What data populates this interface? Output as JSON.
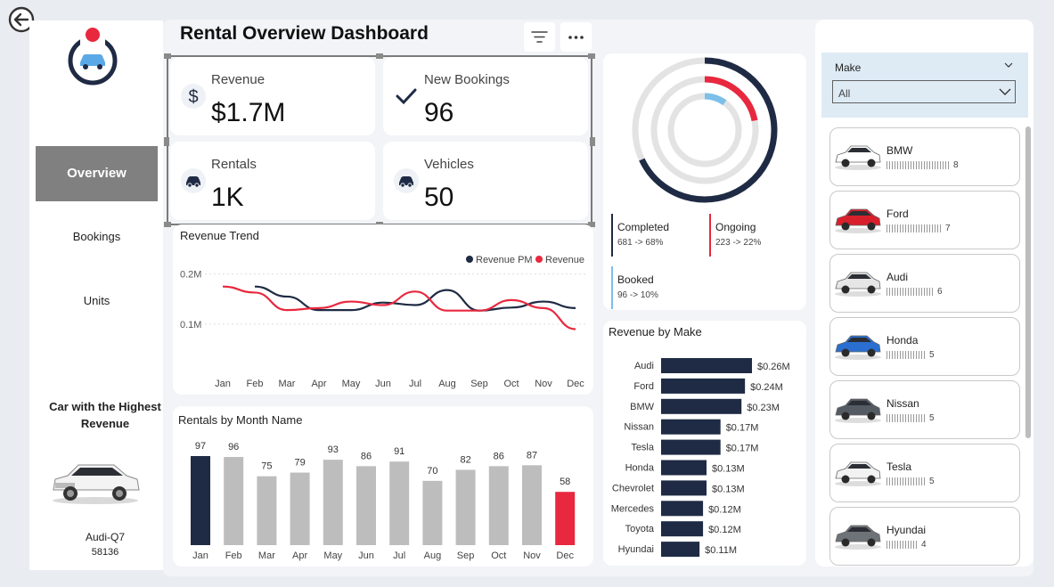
{
  "header": {
    "title": "Rental Overview Dashboard"
  },
  "nav": {
    "items": [
      {
        "label": "Overview"
      },
      {
        "label": "Bookings"
      },
      {
        "label": "Units"
      }
    ]
  },
  "top_car": {
    "title": "Car with the Highest Revenue",
    "name": "Audi-Q7",
    "value": "58136"
  },
  "kpis": [
    {
      "label": "Revenue",
      "value": "$1.7M",
      "icon": "dollar-icon"
    },
    {
      "label": "New Bookings",
      "value": "96",
      "icon": "checkmark-icon"
    },
    {
      "label": "Rentals",
      "value": "1K",
      "icon": "car-icon"
    },
    {
      "label": "Vehicles",
      "value": "50",
      "icon": "car-icon"
    }
  ],
  "status": [
    {
      "label": "Completed",
      "detail": "681 -> 68%",
      "color": "#1f2b44",
      "fraction": 0.68
    },
    {
      "label": "Ongoing",
      "detail": "223 -> 22%",
      "color": "#e8283e",
      "fraction": 0.22
    },
    {
      "label": "Booked",
      "detail": "96 -> 10%",
      "color": "#7cc0ea",
      "fraction": 0.1
    }
  ],
  "slicer": {
    "label": "Make",
    "value": "All"
  },
  "makes": [
    {
      "name": "BMW",
      "count": "8",
      "color": "#ffffff"
    },
    {
      "name": "Ford",
      "count": "7",
      "color": "#d8202c"
    },
    {
      "name": "Audi",
      "count": "6",
      "color": "#e6e6e6"
    },
    {
      "name": "Honda",
      "count": "5",
      "color": "#2a6fcf"
    },
    {
      "name": "Nissan",
      "count": "5",
      "color": "#555b63"
    },
    {
      "name": "Tesla",
      "count": "5",
      "color": "#f2f2f2"
    },
    {
      "name": "Hyundai",
      "count": "4",
      "color": "#6e7378"
    }
  ],
  "chart_data": [
    {
      "type": "line",
      "title": "Revenue Trend",
      "x": [
        "Jan",
        "Feb",
        "Mar",
        "Apr",
        "May",
        "Jun",
        "Jul",
        "Aug",
        "Sep",
        "Oct",
        "Nov",
        "Dec"
      ],
      "y_ticks": [
        "0.2M",
        "0.1M"
      ],
      "ylim": [
        0.05,
        0.21
      ],
      "legend_position": "top-right",
      "grid": true,
      "series": [
        {
          "name": "Revenue PM",
          "color": "#1f2b44",
          "values": [
            null,
            0.175,
            0.155,
            0.128,
            0.128,
            0.143,
            0.138,
            0.168,
            0.127,
            0.133,
            0.145,
            0.132
          ]
        },
        {
          "name": "Revenue",
          "color": "#e8283e",
          "values": [
            0.175,
            0.163,
            0.128,
            0.132,
            0.145,
            0.138,
            0.165,
            0.127,
            0.127,
            0.148,
            0.132,
            0.09
          ]
        }
      ]
    },
    {
      "type": "bar",
      "title": "Rentals by Month Name",
      "categories": [
        "Jan",
        "Feb",
        "Mar",
        "Apr",
        "May",
        "Jun",
        "Jul",
        "Aug",
        "Sep",
        "Oct",
        "Nov",
        "Dec"
      ],
      "values": [
        97,
        96,
        75,
        79,
        93,
        86,
        91,
        70,
        82,
        86,
        87,
        58
      ],
      "colors": [
        "#1f2b44",
        "#bdbdbd",
        "#bdbdbd",
        "#bdbdbd",
        "#bdbdbd",
        "#bdbdbd",
        "#bdbdbd",
        "#bdbdbd",
        "#bdbdbd",
        "#bdbdbd",
        "#bdbdbd",
        "#e8283e"
      ],
      "ylim": [
        0,
        97
      ]
    },
    {
      "type": "bar",
      "orientation": "horizontal",
      "title": "Revenue by Make",
      "categories": [
        "Audi",
        "Ford",
        "BMW",
        "Nissan",
        "Tesla",
        "Honda",
        "Chevrolet",
        "Mercedes",
        "Toyota",
        "Hyundai"
      ],
      "values": [
        0.26,
        0.24,
        0.23,
        0.17,
        0.17,
        0.13,
        0.13,
        0.12,
        0.12,
        0.11
      ],
      "labels": [
        "$0.26M",
        "$0.24M",
        "$0.23M",
        "$0.17M",
        "$0.17M",
        "$0.13M",
        "$0.13M",
        "$0.12M",
        "$0.12M",
        "$0.11M"
      ],
      "color": "#1f2b44"
    }
  ]
}
